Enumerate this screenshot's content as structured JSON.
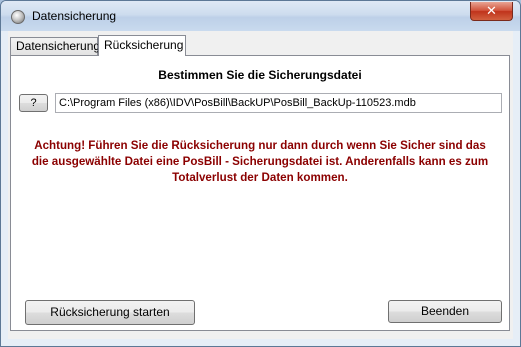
{
  "window": {
    "title": "Datensicherung",
    "close_glyph": "✕",
    "icon": "app-disc-icon"
  },
  "tabs": [
    {
      "label": "Datensicherung",
      "active": false
    },
    {
      "label": "Rücksicherung",
      "active": true
    }
  ],
  "restore": {
    "heading": "Bestimmen Sie die Sicherungsdatei",
    "browse_label": "?",
    "file_path": "C:\\Program Files (x86)\\IDV\\PosBill\\BackUP\\PosBill_BackUp-110523.mdb",
    "warning_lines": [
      "Achtung! Führen Sie die Rücksicherung nur dann durch wenn Sie Sicher sind das",
      "die ausgewählte Datei eine PosBill - Sicherungsdatei ist. Anderenfalls kann es zum",
      "Totalverlust der Daten kommen."
    ],
    "warning_color": "#8b0000",
    "start_button": "Rücksicherung starten",
    "exit_button": "Beenden"
  }
}
